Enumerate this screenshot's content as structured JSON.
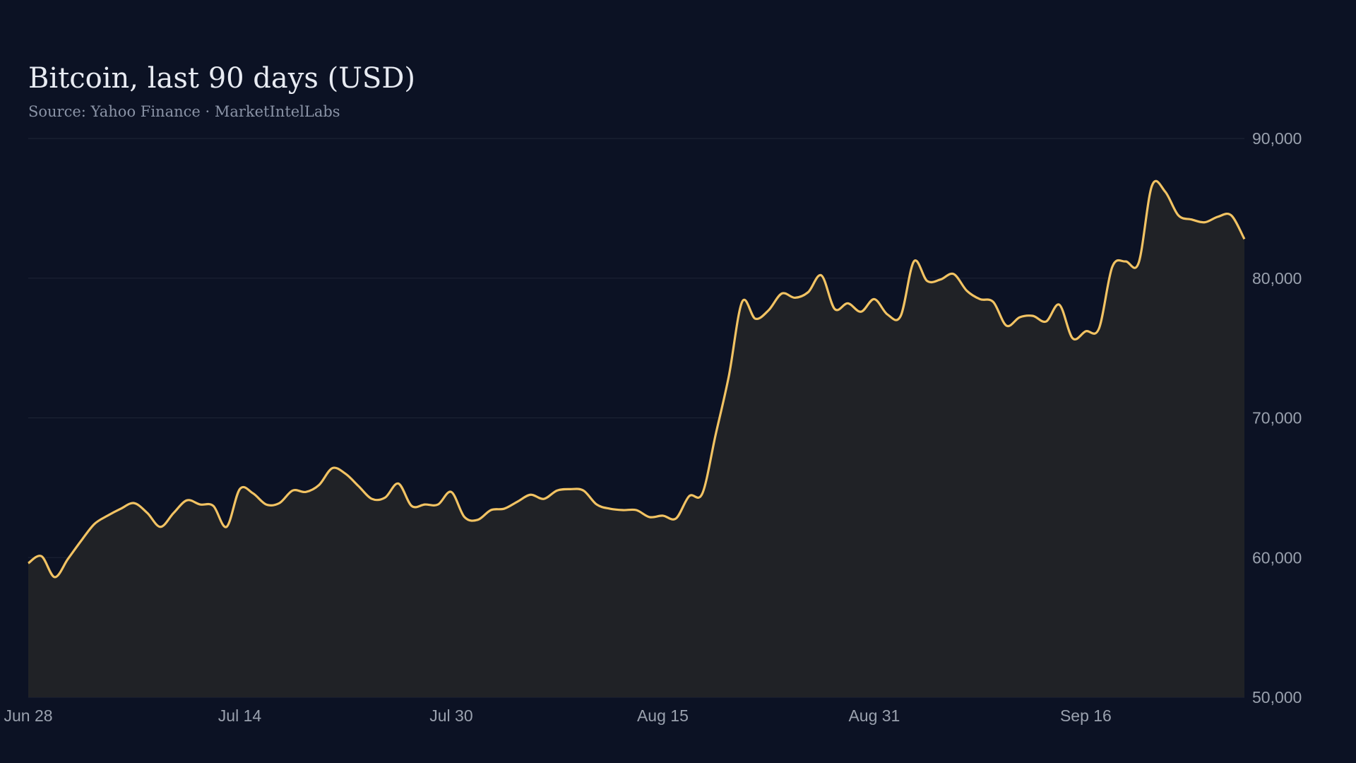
{
  "title": "Bitcoin, last 90 days (USD)",
  "subtitle": "Source: Yahoo Finance · MarketIntelLabs",
  "colors": {
    "background": "#0c1224",
    "line": "#f2c363",
    "area": "#202226",
    "grid": "#1e2536"
  },
  "chart_data": {
    "type": "area",
    "title": "Bitcoin, last 90 days (USD)",
    "subtitle": "Source: Yahoo Finance · MarketIntelLabs",
    "xlabel": "",
    "ylabel": "",
    "x_tick_labels": [
      "Jun 28",
      "Jul 14",
      "Jul 30",
      "Aug 15",
      "Aug 31",
      "Sep 16"
    ],
    "y_ticks": [
      50000,
      60000,
      70000,
      80000,
      90000
    ],
    "y_tick_labels": [
      "50,000",
      "60,000",
      "70,000",
      "80,000",
      "90,000"
    ],
    "ylim": [
      50000,
      90000
    ],
    "y_axis_position": "right",
    "grid": "horizontal",
    "legend": "none",
    "series": [
      {
        "dates": [
          "Jun 28",
          "Jun 29",
          "Jun 30",
          "Jul 1",
          "Jul 2",
          "Jul 3",
          "Jul 4",
          "Jul 5",
          "Jul 6",
          "Jul 7",
          "Jul 8",
          "Jul 9",
          "Jul 10",
          "Jul 11",
          "Jul 12",
          "Jul 13",
          "Jul 14",
          "Jul 15",
          "Jul 16",
          "Jul 17",
          "Jul 18",
          "Jul 19",
          "Jul 20",
          "Jul 21",
          "Jul 22",
          "Jul 23",
          "Jul 24",
          "Jul 25",
          "Jul 26",
          "Jul 27",
          "Jul 28",
          "Jul 29",
          "Jul 30",
          "Jul 31",
          "Aug 1",
          "Aug 2",
          "Aug 3",
          "Aug 4",
          "Aug 5",
          "Aug 6",
          "Aug 7",
          "Aug 8",
          "Aug 9",
          "Aug 10",
          "Aug 11",
          "Aug 12",
          "Aug 13",
          "Aug 14",
          "Aug 15",
          "Aug 16",
          "Aug 17",
          "Aug 18",
          "Aug 19",
          "Aug 20",
          "Aug 21",
          "Aug 22",
          "Aug 23",
          "Aug 24",
          "Aug 25",
          "Aug 26",
          "Aug 27",
          "Aug 28",
          "Aug 29",
          "Aug 30",
          "Aug 31",
          "Sep 1",
          "Sep 2",
          "Sep 3",
          "Sep 4",
          "Sep 5",
          "Sep 6",
          "Sep 7",
          "Sep 8",
          "Sep 9",
          "Sep 10",
          "Sep 11",
          "Sep 12",
          "Sep 13",
          "Sep 14",
          "Sep 15",
          "Sep 16",
          "Sep 17",
          "Sep 18",
          "Sep 19",
          "Sep 20",
          "Sep 21",
          "Sep 22",
          "Sep 23",
          "Sep 24",
          "Sep 25"
        ],
        "values": [
          59600,
          60100,
          58600,
          59900,
          61200,
          62400,
          63000,
          63500,
          63900,
          63200,
          62200,
          63200,
          64100,
          63800,
          63700,
          62200,
          64900,
          64600,
          63800,
          63900,
          64800,
          64700,
          65200,
          66400,
          66000,
          65100,
          64200,
          64300,
          65300,
          63700,
          63800,
          63800,
          64700,
          62900,
          62700,
          63400,
          63500,
          64000,
          64500,
          64200,
          64800,
          64900,
          64800,
          63800,
          63500,
          63400,
          63400,
          62900,
          63000,
          62800,
          64400,
          64600,
          68800,
          73000,
          78300,
          77100,
          77700,
          78900,
          78600,
          79000,
          80200,
          77800,
          78200,
          77600,
          78500,
          77400,
          77300,
          81200,
          79800,
          79900,
          80300,
          79100,
          78500,
          78300,
          76600,
          77200,
          77300,
          76900,
          78100,
          75700,
          76200,
          76400,
          80800,
          81200,
          81100,
          86600,
          86200,
          84500,
          84200,
          84000,
          84400,
          84500,
          82800
        ]
      }
    ]
  }
}
